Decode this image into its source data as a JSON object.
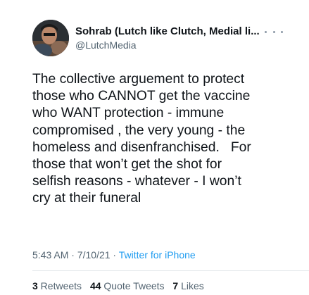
{
  "author": {
    "display_name": "Sohrab (Lutch like Clutch, Medial li...",
    "handle": "@LutchMedia"
  },
  "tweet": {
    "text": "The collective arguement to protect\nthose who CANNOT get the vaccine\nwho WANT protection - immune\ncompromised , the very young - the\nhomeless and disenfranchised.   For\nthose that won’t get the shot for\nselfish reasons - whatever - I won’t\ncry at their funeral",
    "time": "5:43 AM",
    "separator": " · ",
    "date": "7/10/21",
    "source": "Twitter for iPhone"
  },
  "stats": {
    "retweets_count": "3",
    "retweets_label": " Retweets",
    "quotes_count": "44",
    "quotes_label": " Quote Tweets",
    "likes_count": "7",
    "likes_label": " Likes"
  },
  "icons": {
    "more": "more-horizontal-icon"
  },
  "colors": {
    "link": "#1d9bf0",
    "secondary_text": "#536471",
    "primary_text": "#0f1419"
  }
}
